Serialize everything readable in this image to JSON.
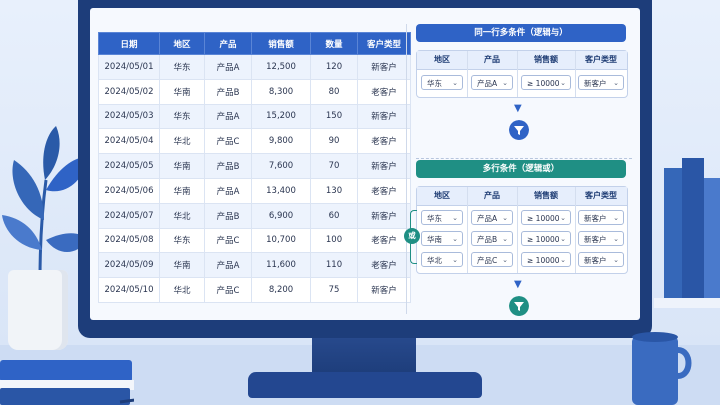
{
  "table": {
    "headers": [
      "日期",
      "地区",
      "产品",
      "销售额",
      "数量",
      "客户类型"
    ],
    "rows": [
      [
        "2024/05/01",
        "华东",
        "产品A",
        "12,500",
        "120",
        "新客户"
      ],
      [
        "2024/05/02",
        "华南",
        "产品B",
        "8,300",
        "80",
        "老客户"
      ],
      [
        "2024/05/03",
        "华东",
        "产品A",
        "15,200",
        "150",
        "新客户"
      ],
      [
        "2024/05/04",
        "华北",
        "产品C",
        "9,800",
        "90",
        "老客户"
      ],
      [
        "2024/05/05",
        "华南",
        "产品B",
        "7,600",
        "70",
        "新客户"
      ],
      [
        "2024/05/06",
        "华南",
        "产品A",
        "13,400",
        "130",
        "老客户"
      ],
      [
        "2024/05/07",
        "华北",
        "产品B",
        "6,900",
        "60",
        "新客户"
      ],
      [
        "2024/05/08",
        "华东",
        "产品C",
        "10,700",
        "100",
        "老客户"
      ],
      [
        "2024/05/09",
        "华南",
        "产品A",
        "11,600",
        "110",
        "老客户"
      ],
      [
        "2024/05/10",
        "华北",
        "产品C",
        "8,200",
        "75",
        "新客户"
      ]
    ]
  },
  "and_panel": {
    "title": "同一行多条件（逻辑与）",
    "headers": [
      "地区",
      "产品",
      "销售额",
      "客户类型"
    ],
    "row": [
      "华东",
      "产品A",
      "≥ 10000",
      "新客户"
    ]
  },
  "or_panel": {
    "title": "多行条件（逻辑或）",
    "badge": "或",
    "headers": [
      "地区",
      "产品",
      "销售额",
      "客户类型"
    ],
    "rows": [
      [
        "华东",
        "产品A",
        "≥ 10000",
        "新客户"
      ],
      [
        "华南",
        "产品B",
        "≥ 10000",
        "新客户"
      ],
      [
        "华北",
        "产品C",
        "≥ 10000",
        "新客户"
      ]
    ]
  },
  "colors": {
    "blue": "#2f63c6",
    "teal": "#1f8f84",
    "bezel": "#1d3d7a"
  },
  "icons": {
    "filter": "funnel-icon",
    "arrow": "arrow-down-icon",
    "dropdown": "chevron-down-icon"
  }
}
